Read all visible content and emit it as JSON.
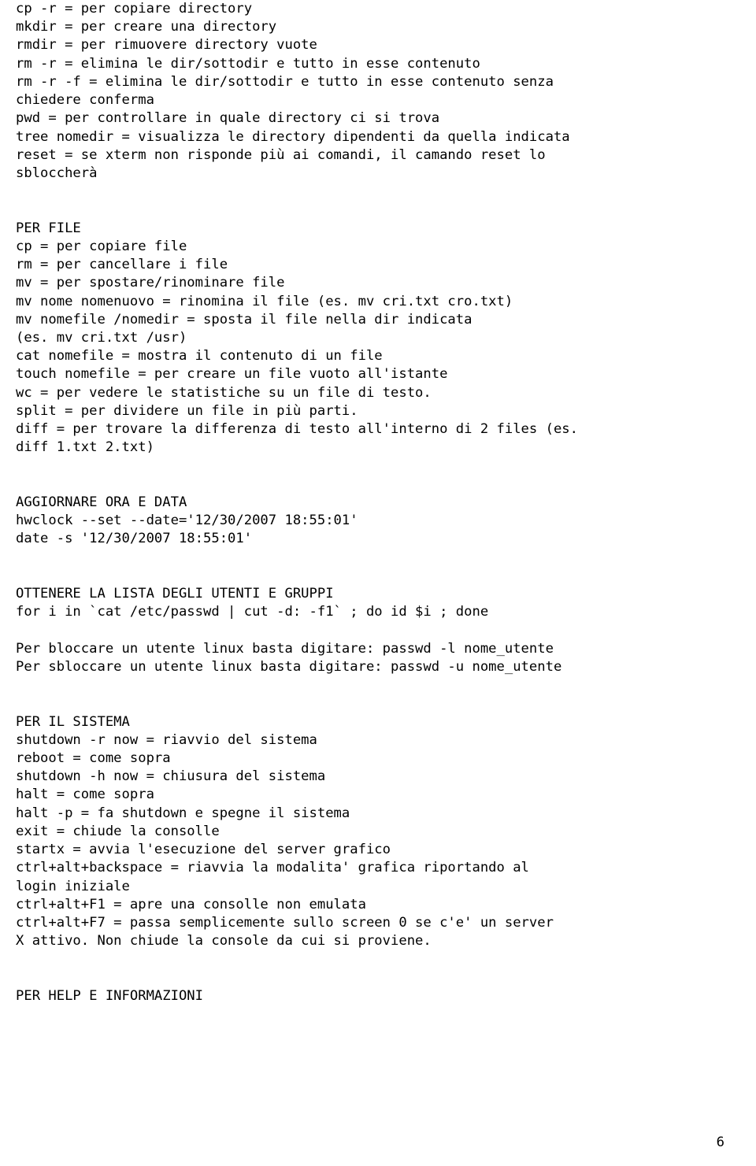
{
  "page_number": "6",
  "sections": {
    "dir": {
      "lines": [
        "cp -r = per copiare directory",
        "mkdir = per creare una directory",
        "rmdir = per rimuovere directory vuote",
        "rm -r = elimina le dir/sottodir e tutto in esse contenuto",
        "rm -r -f = elimina le dir/sottodir e tutto in esse contenuto senza",
        "chiedere conferma",
        "pwd = per controllare in quale directory ci si trova",
        "tree nomedir = visualizza le directory dipendenti da quella indicata",
        "reset = se xterm non risponde più ai comandi, il camando reset lo",
        "sbloccherà"
      ]
    },
    "file": {
      "title": "PER FILE",
      "lines": [
        "cp = per copiare file",
        "rm = per cancellare i file",
        "mv = per spostare/rinominare file",
        "mv nome nomenuovo = rinomina il file (es. mv cri.txt cro.txt)",
        "mv nomefile /nomedir = sposta il file nella dir indicata",
        "(es. mv cri.txt /usr)",
        "cat nomefile = mostra il contenuto di un file",
        "touch nomefile = per creare un file vuoto all'istante",
        "wc = per vedere le statistiche su un file di testo.",
        "split = per dividere un file in più parti.",
        "diff = per trovare la differenza di testo all'interno di 2 files (es.",
        "diff 1.txt 2.txt)"
      ]
    },
    "clock": {
      "title": "AGGIORNARE ORA E DATA",
      "lines": [
        "hwclock --set --date='12/30/2007 18:55:01'",
        "date -s '12/30/2007 18:55:01'"
      ]
    },
    "users": {
      "title": "OTTENERE LA LISTA DEGLI UTENTI E GRUPPI",
      "lines": [
        "for i in `cat /etc/passwd | cut -d: -f1` ; do id $i ; done",
        "",
        "Per bloccare un utente linux basta digitare: passwd -l nome_utente",
        "Per sbloccare un utente linux basta digitare: passwd -u nome_utente"
      ]
    },
    "system": {
      "title": "PER IL SISTEMA",
      "lines": [
        "shutdown -r now = riavvio del sistema",
        "reboot = come sopra",
        "shutdown -h now = chiusura del sistema",
        "halt = come sopra",
        "halt -p = fa shutdown e spegne il sistema",
        "exit = chiude la consolle",
        "startx = avvia l'esecuzione del server grafico",
        "ctrl+alt+backspace = riavvia la modalita' grafica riportando al",
        "login iniziale",
        "ctrl+alt+F1 = apre una consolle non emulata",
        "ctrl+alt+F7 = passa semplicemente sullo screen 0 se c'e' un server",
        "X attivo. Non chiude la console da cui si proviene."
      ]
    },
    "help": {
      "title": "PER HELP E INFORMAZIONI"
    }
  }
}
